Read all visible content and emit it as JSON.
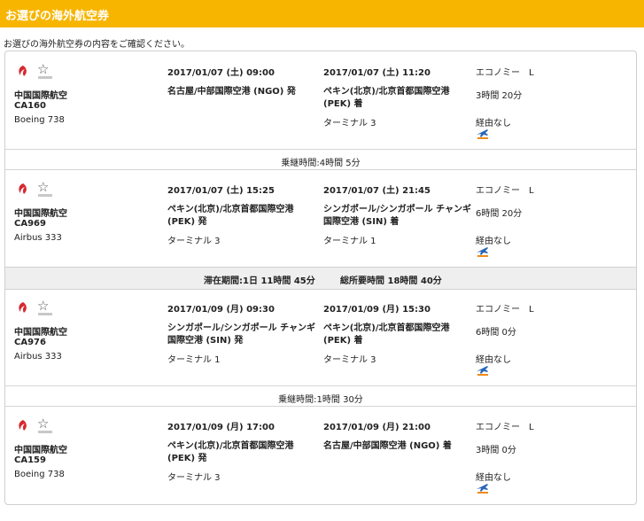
{
  "header": {
    "title": "お選びの海外航空券"
  },
  "subtitle": "お選びの海外航空券の内容をご確認ください。",
  "segments": [
    {
      "airline": "中国国際航空",
      "flight": "CA160",
      "aircraft": "Boeing 738",
      "dep_time": "2017/01/07 (土) 09:00",
      "dep_airport": "名古屋/中部国際空港 (NGO) 発",
      "dep_terminal": "",
      "arr_time": "2017/01/07 (土) 11:20",
      "arr_airport": "ペキン(北京)/北京首都国際空港 (PEK) 着",
      "arr_terminal": "ターミナル 3",
      "class": "エコノミー　L",
      "duration": "3時間 20分",
      "stops": "経由なし"
    },
    {
      "airline": "中国国際航空",
      "flight": "CA969",
      "aircraft": "Airbus 333",
      "dep_time": "2017/01/07 (土) 15:25",
      "dep_airport": "ペキン(北京)/北京首都国際空港 (PEK) 発",
      "dep_terminal": "ターミナル 3",
      "arr_time": "2017/01/07 (土) 21:45",
      "arr_airport": "シンガポール/シンガポール チャンギ国際空港 (SIN) 着",
      "arr_terminal": "ターミナル 1",
      "class": "エコノミー　L",
      "duration": "6時間 20分",
      "stops": "経由なし"
    },
    {
      "airline": "中国国際航空",
      "flight": "CA976",
      "aircraft": "Airbus 333",
      "dep_time": "2017/01/09 (月) 09:30",
      "dep_airport": "シンガポール/シンガポール チャンギ国際空港 (SIN) 発",
      "dep_terminal": "ターミナル 1",
      "arr_time": "2017/01/09 (月) 15:30",
      "arr_airport": "ペキン(北京)/北京首都国際空港 (PEK) 着",
      "arr_terminal": "ターミナル 3",
      "class": "エコノミー　L",
      "duration": "6時間 0分",
      "stops": "経由なし"
    },
    {
      "airline": "中国国際航空",
      "flight": "CA159",
      "aircraft": "Boeing 738",
      "dep_time": "2017/01/09 (月) 17:00",
      "dep_airport": "ペキン(北京)/北京首都国際空港 (PEK) 発",
      "dep_terminal": "ターミナル 3",
      "arr_time": "2017/01/09 (月) 21:00",
      "arr_airport": "名古屋/中部国際空港 (NGO) 着",
      "arr_terminal": "",
      "class": "エコノミー　L",
      "duration": "3時間 0分",
      "stops": "経由なし"
    }
  ],
  "connections": [
    "乗継時間:4時間 5分",
    "乗継時間:1時間 30分"
  ],
  "stay": {
    "stay_period": "滞在期間:1日 11時間 45分",
    "total_time": "総所要時間 18時間 40分"
  },
  "colors": {
    "header": "#f7b500",
    "logo_red": "#d8282f",
    "plane_blue": "#2a67b8",
    "plane_orange": "#f08a1a"
  }
}
